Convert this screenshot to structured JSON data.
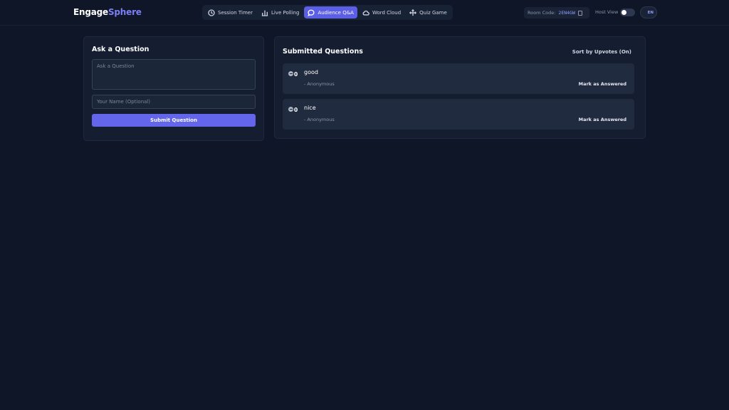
{
  "brand": {
    "part1": "Engage",
    "part2": "Sphere"
  },
  "nav": [
    {
      "label": "Session Timer",
      "icon": "clock-icon"
    },
    {
      "label": "Live Polling",
      "icon": "bar-chart-icon"
    },
    {
      "label": "Audience Q&A",
      "icon": "chat-bubble-icon",
      "active": true
    },
    {
      "label": "Word Cloud",
      "icon": "cloud-icon"
    },
    {
      "label": "Quiz Game",
      "icon": "arrows-icon"
    }
  ],
  "room": {
    "label": "Room Code:",
    "code": "2EN4GW",
    "copy_icon": "clipboard-icon"
  },
  "host_view": {
    "label": "Host View",
    "enabled": false
  },
  "language": {
    "label": "EN"
  },
  "ask": {
    "title": "Ask a Question",
    "question_placeholder": "Ask a Question",
    "question_value": "",
    "name_placeholder": "Your Name (Optional)",
    "name_value": "",
    "submit_label": "Submit Question"
  },
  "submitted": {
    "title": "Submitted Questions",
    "sort_label": "Sort by Upvotes (On)",
    "questions": [
      {
        "text": "good",
        "author": "- Anonymous",
        "votes": "0",
        "action": "Mark as Answered"
      },
      {
        "text": "nice",
        "author": "- Anonymous",
        "votes": "0",
        "action": "Mark as Answered"
      }
    ]
  },
  "colors": {
    "background": "#0e1628",
    "panel": "#151e31",
    "accent": "#6365ea",
    "brand_accent": "#7d7ff5"
  }
}
